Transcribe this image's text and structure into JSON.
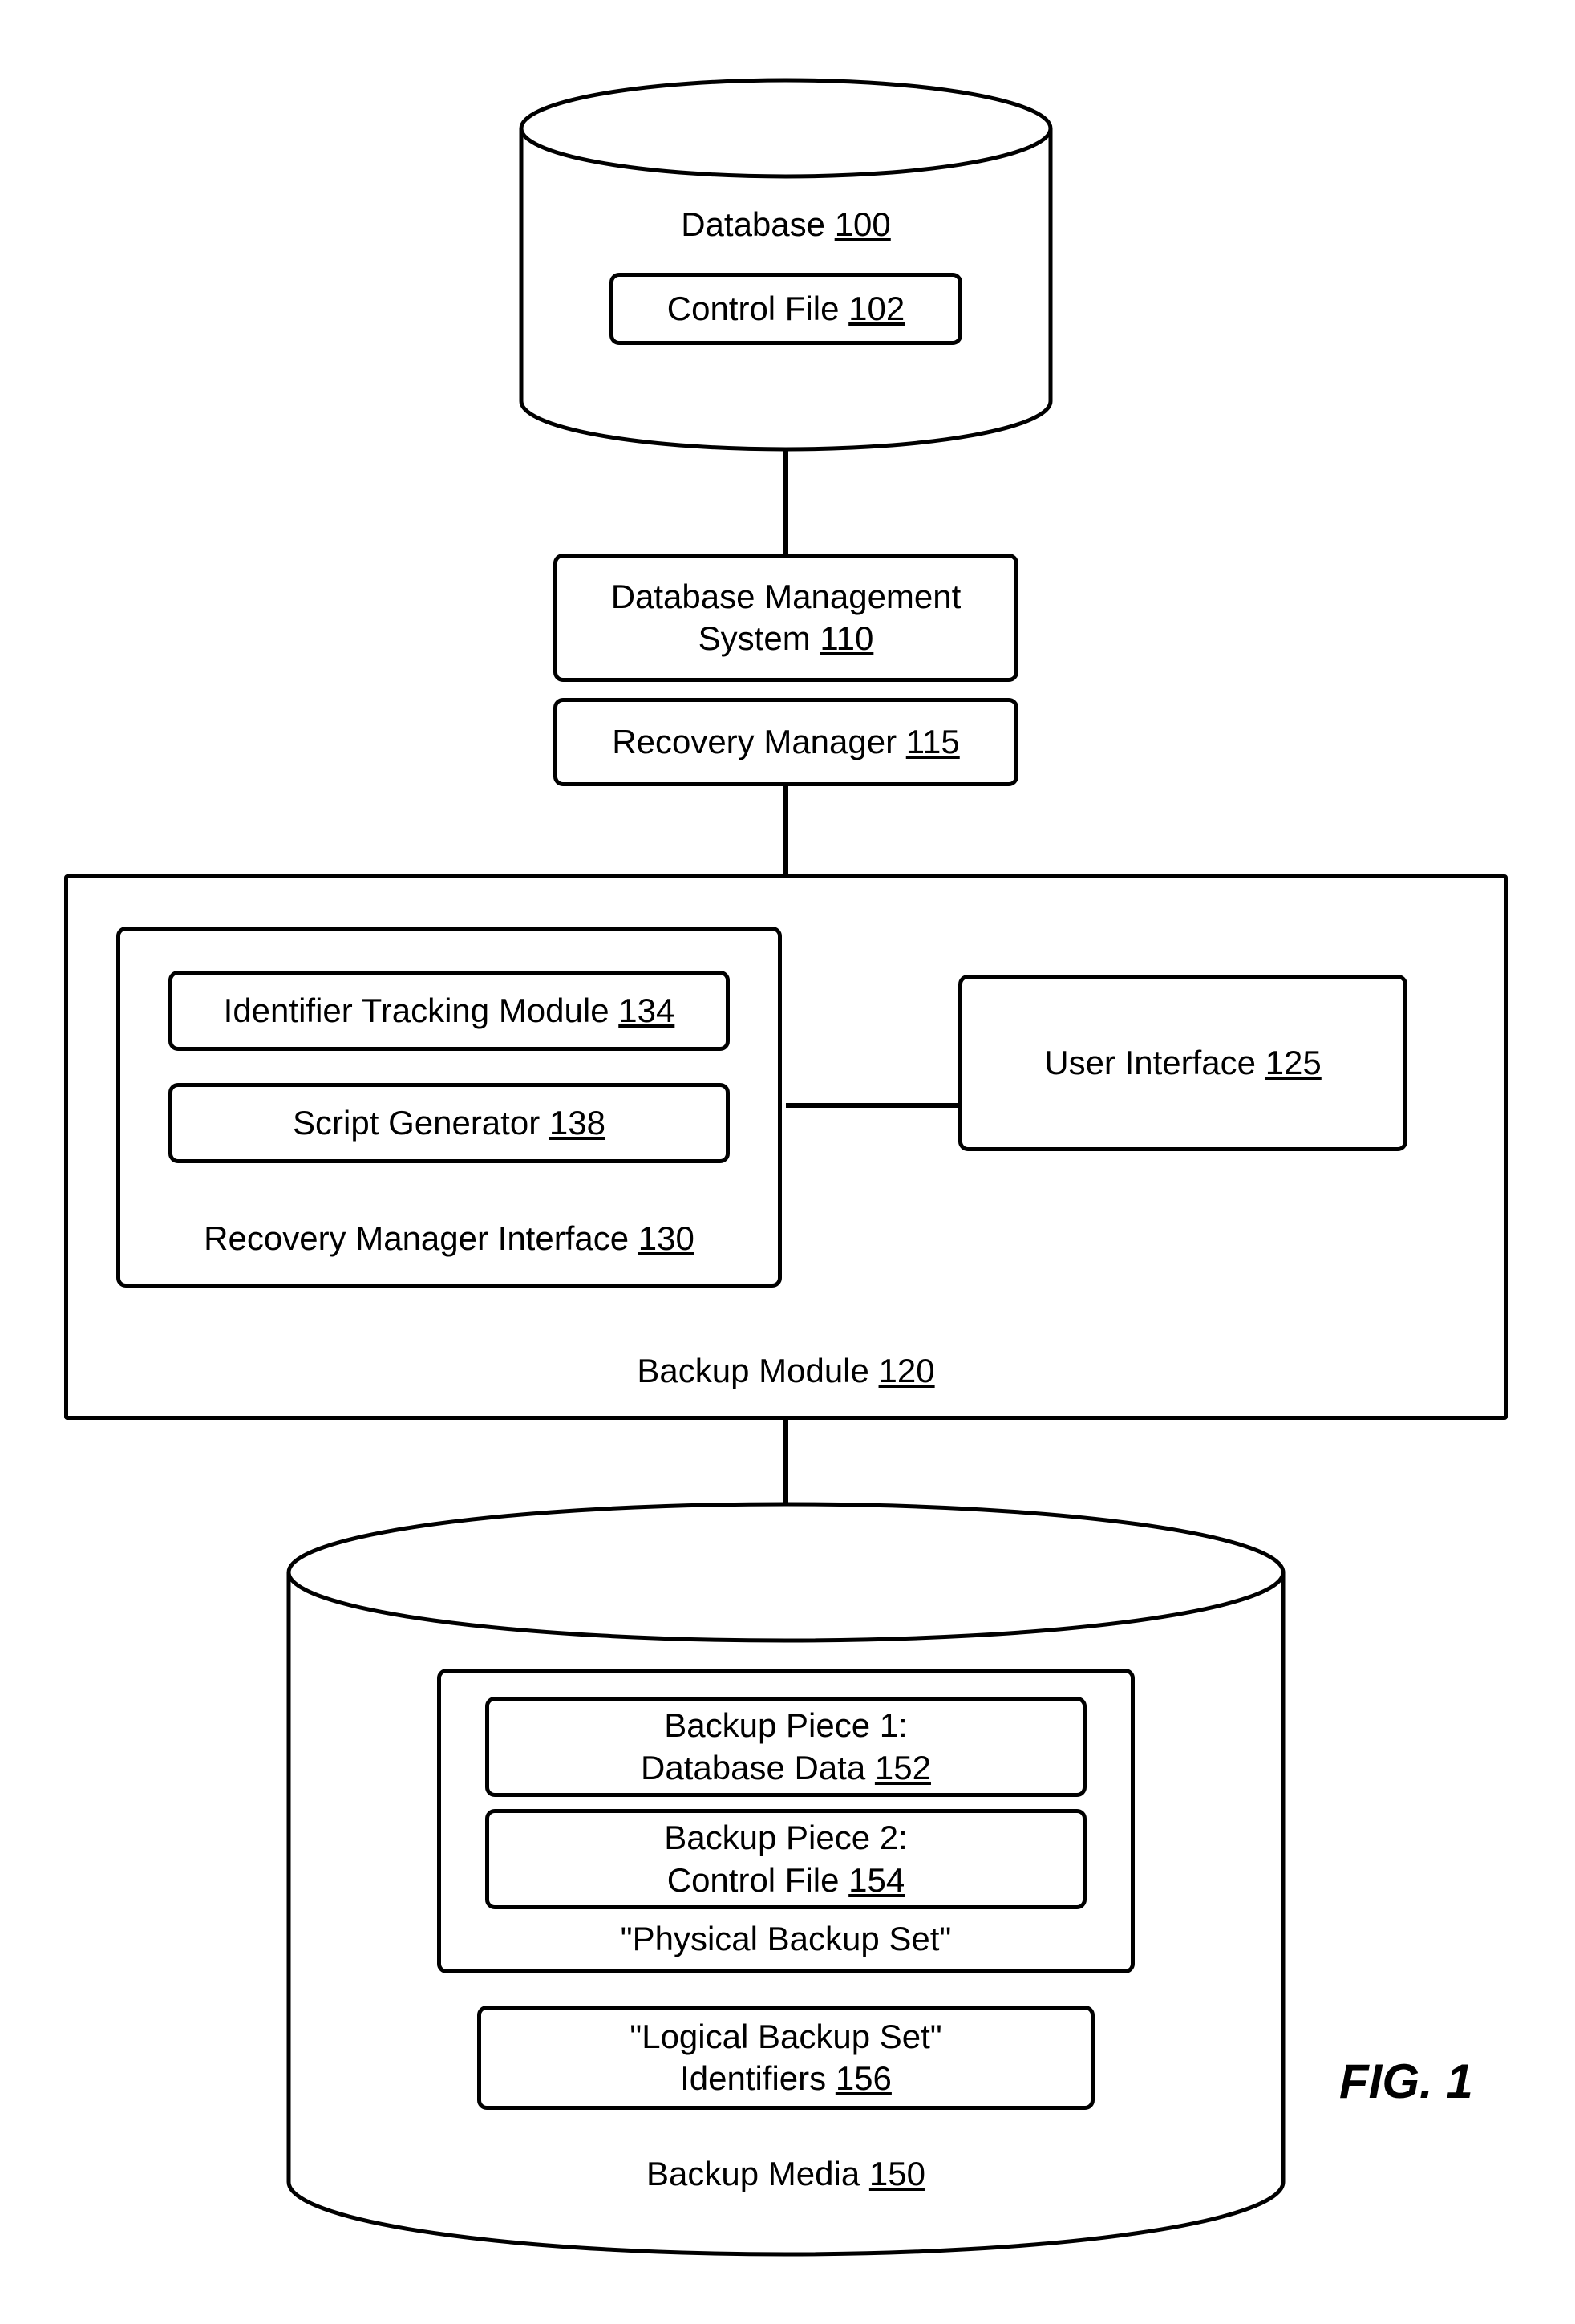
{
  "database": {
    "title": "Database",
    "ref": "100",
    "control_file": {
      "title": "Control File",
      "ref": "102"
    }
  },
  "dbms": {
    "title": "Database Management\nSystem",
    "ref": "110"
  },
  "recovery_manager": {
    "title": "Recovery Manager",
    "ref": "115"
  },
  "backup_module": {
    "title": "Backup Module",
    "ref": "120",
    "rmi": {
      "title": "Recovery Manager Interface",
      "ref": "130",
      "identifier_tracking": {
        "title": "Identifier Tracking Module",
        "ref": "134"
      },
      "script_generator": {
        "title": "Script Generator",
        "ref": "138"
      }
    },
    "user_interface": {
      "title": "User Interface",
      "ref": "125"
    }
  },
  "backup_media": {
    "title": "Backup Media",
    "ref": "150",
    "physical": {
      "title": "\"Physical Backup Set\"",
      "bp1": {
        "title": "Backup Piece 1:\nDatabase Data",
        "ref": "152"
      },
      "bp2": {
        "title": "Backup Piece 2:\nControl File",
        "ref": "154"
      }
    },
    "logical": {
      "title": "\"Logical Backup Set\"\nIdentifiers",
      "ref": "156"
    }
  },
  "figure": "FIG. 1"
}
